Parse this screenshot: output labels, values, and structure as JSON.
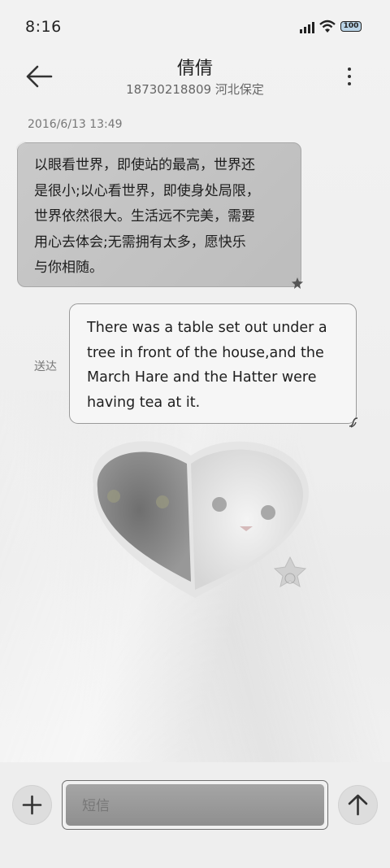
{
  "status_bar": {
    "time": "8:16",
    "battery": "100",
    "icons": [
      "signal-icon",
      "wifi-icon",
      "battery-icon"
    ]
  },
  "header": {
    "contact_name": "倩倩",
    "contact_detail": "18730218809 河北保定",
    "back_icon": "arrow-left-icon",
    "more_icon": "more-vertical-icon"
  },
  "conversation": {
    "timestamp": "2016/6/13 13:49",
    "messages": [
      {
        "direction": "incoming",
        "lines": [
          "以眼看世界，即使站的最高，世界还",
          "是很小;以心看世界，即使身处局限，",
          "世界依然很大。生活远不完美，需要",
          "用心去体会;无需拥有太多，愿快乐",
          "与你相随。"
        ]
      },
      {
        "direction": "outgoing",
        "status": "送达",
        "lines": [
          "There was a table set out under a",
          "tree in front of the house,and the",
          "March Hare and the Hatter were",
          "having tea at it."
        ]
      }
    ]
  },
  "composer": {
    "placeholder": "短信",
    "add_icon": "plus-icon",
    "send_icon": "arrow-up-icon"
  },
  "colors": {
    "background": "#f1f1f1",
    "incoming_bubble": "#c4c4c4",
    "outgoing_bubble": "#f6f6f6",
    "input_fill": "#9a9a9a"
  }
}
